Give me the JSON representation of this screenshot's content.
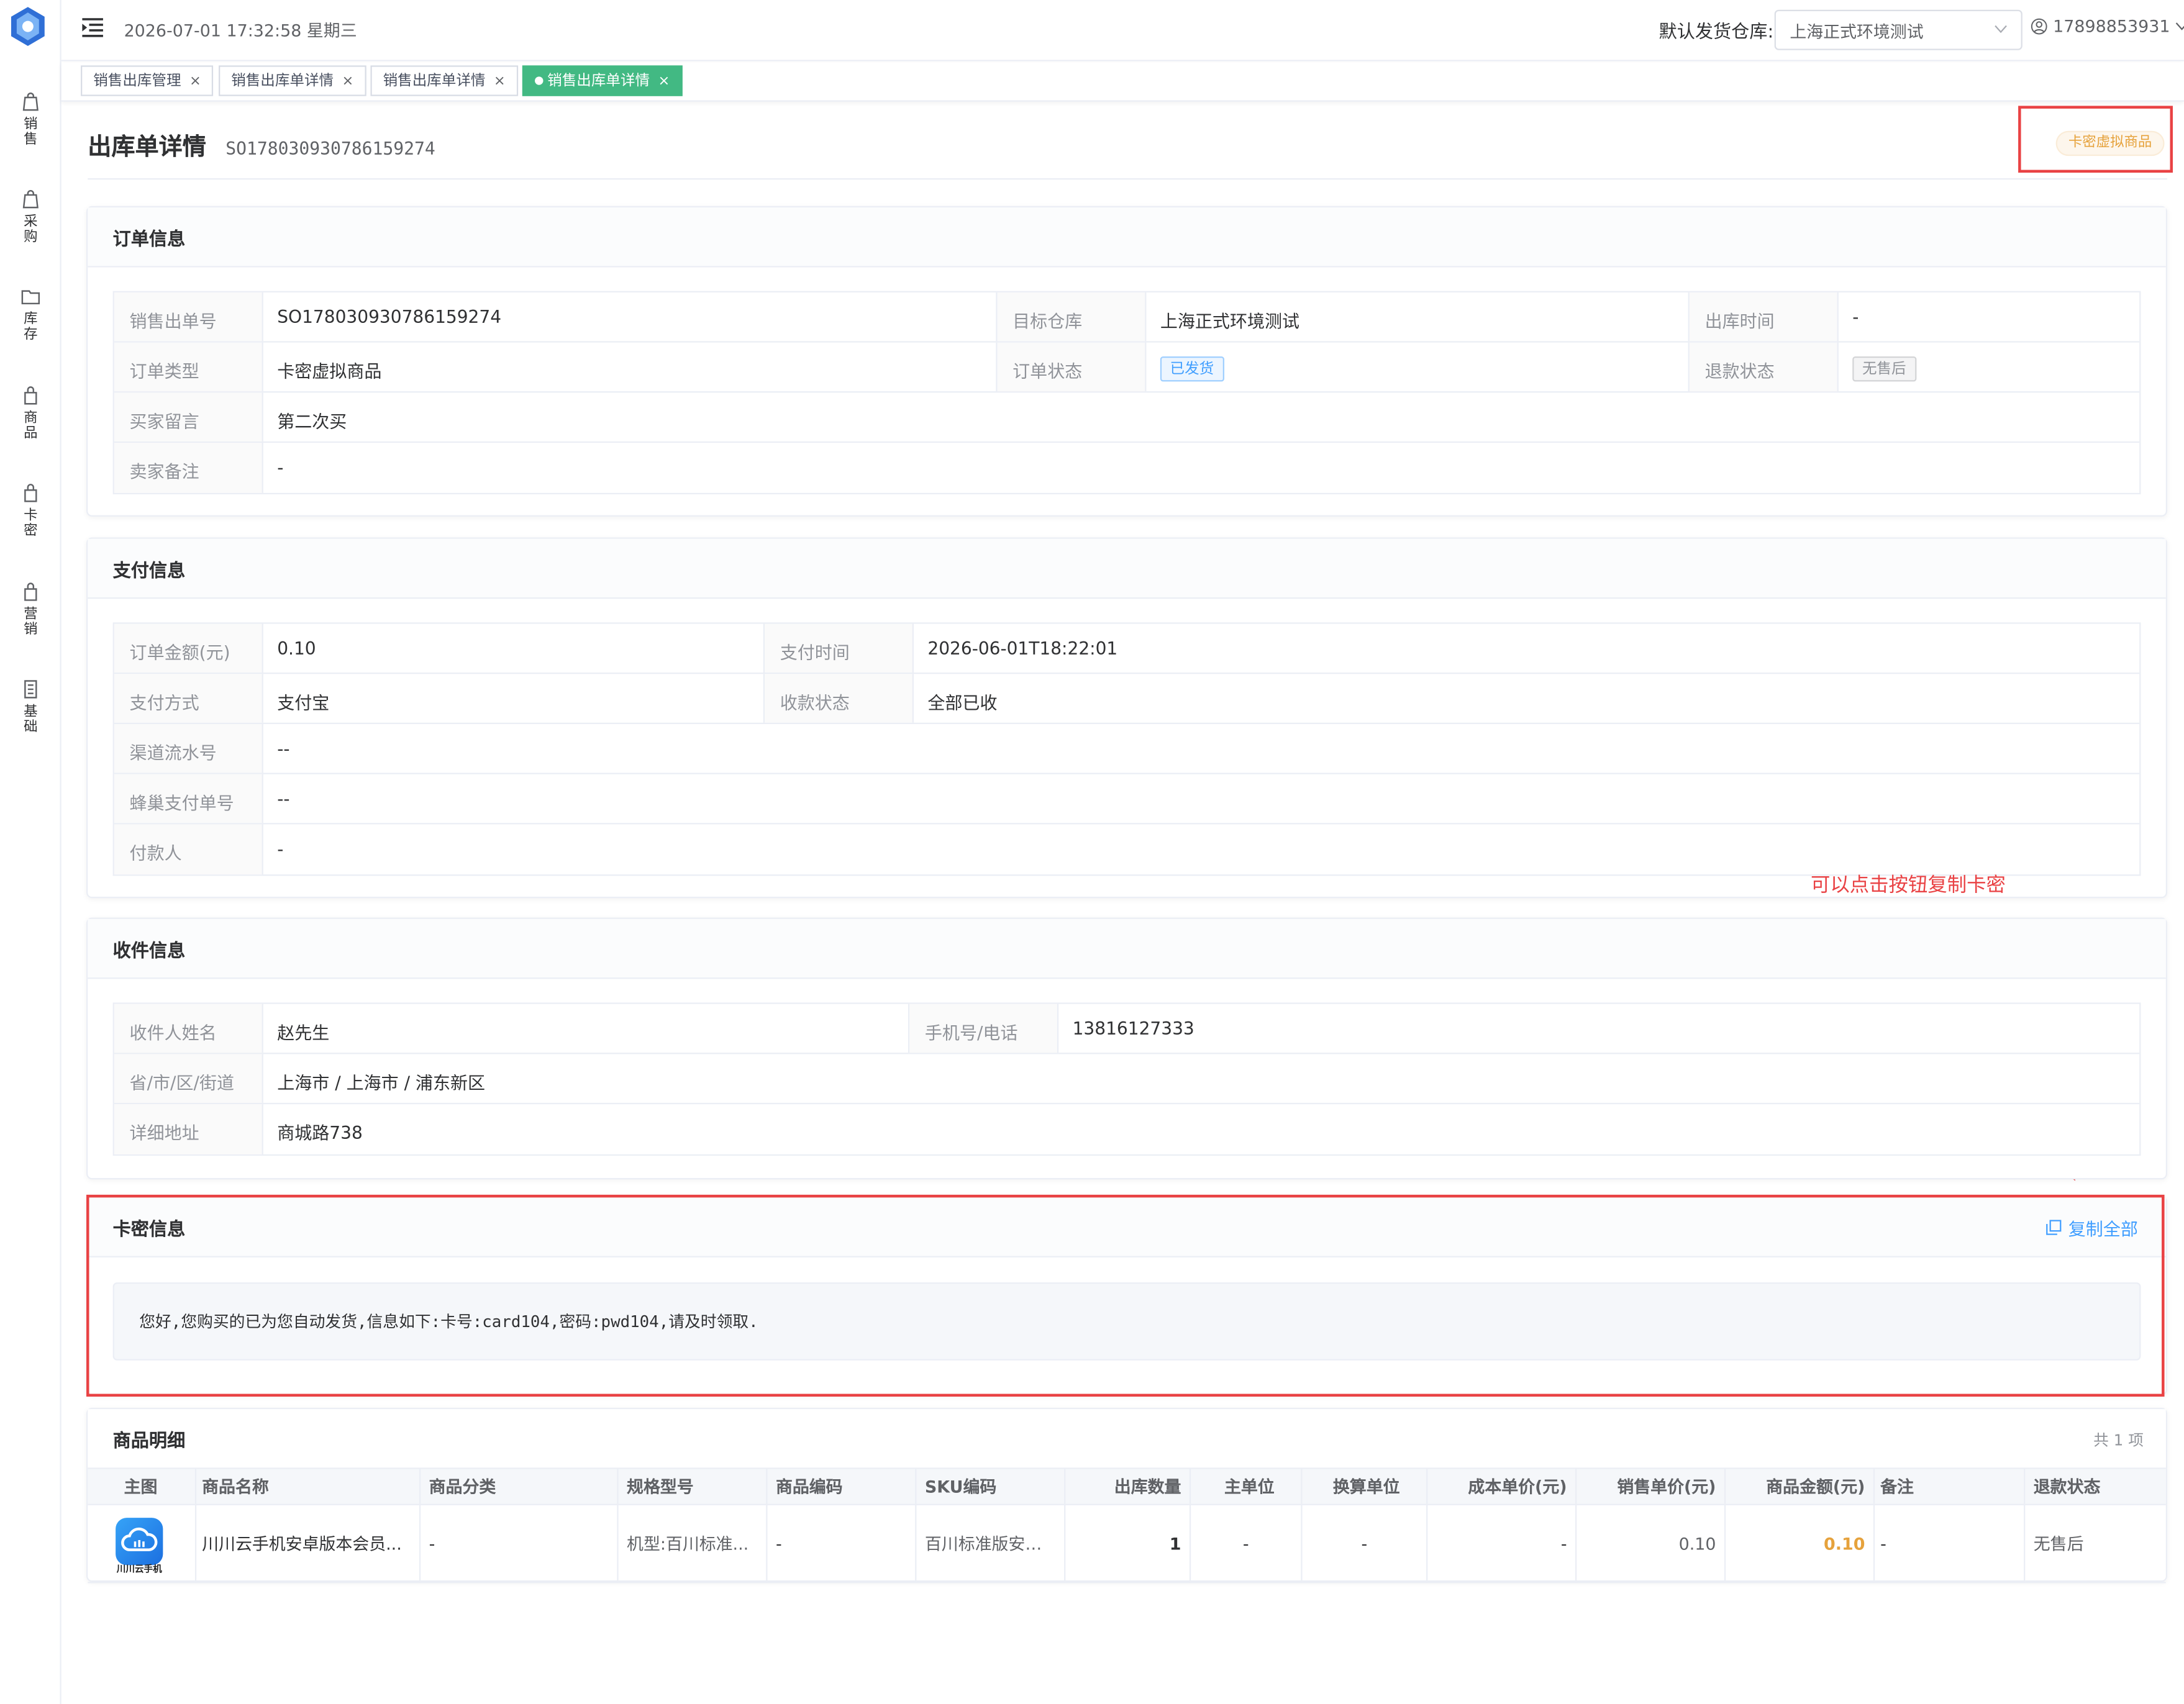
{
  "sidebar": {
    "items": [
      {
        "label": "销售",
        "icon": "sales-bag-icon"
      },
      {
        "label": "采购",
        "icon": "purchase-bag-icon"
      },
      {
        "label": "库存",
        "icon": "inventory-folder-icon"
      },
      {
        "label": "商品",
        "icon": "goods-bag-icon"
      },
      {
        "label": "卡密",
        "icon": "card-bag-icon"
      },
      {
        "label": "营销",
        "icon": "marketing-bag-icon"
      },
      {
        "label": "基础",
        "icon": "basic-book-icon"
      }
    ]
  },
  "topbar": {
    "datetime": "2026-07-01 17:32:58 星期三",
    "warehouse_label": "默认发货仓库:",
    "warehouse_value": "上海正式环境测试",
    "user": "17898853931"
  },
  "tabs": [
    {
      "label": "销售出库管理"
    },
    {
      "label": "销售出库单详情"
    },
    {
      "label": "销售出库单详情"
    },
    {
      "label": "销售出库单详情"
    }
  ],
  "page": {
    "title": "出库单详情",
    "code": "SO178030930786159274",
    "type_tag": "卡密虚拟商品"
  },
  "order_info": {
    "title": "订单信息",
    "rows": [
      [
        [
          "销售出单号",
          "SO178030930786159274"
        ],
        [
          "目标仓库",
          "上海正式环境测试"
        ],
        [
          "出库时间",
          "-"
        ]
      ],
      [
        [
          "订单类型",
          "卡密虚拟商品"
        ],
        [
          "订单状态",
          "已发货"
        ],
        [
          "退款状态",
          "无售后"
        ]
      ],
      [
        [
          "买家留言",
          "第二次买"
        ]
      ],
      [
        [
          "卖家备注",
          "-"
        ]
      ]
    ]
  },
  "payment_info": {
    "title": "支付信息",
    "rows": [
      [
        [
          "订单金额(元)",
          "0.10"
        ],
        [
          "支付时间",
          "2026-06-01T18:22:01"
        ]
      ],
      [
        [
          "支付方式",
          "支付宝"
        ],
        [
          "收款状态",
          "全部已收"
        ]
      ],
      [
        [
          "渠道流水号",
          "--"
        ]
      ],
      [
        [
          "蜂巢支付单号",
          "--"
        ]
      ],
      [
        [
          "付款人",
          "-"
        ]
      ]
    ]
  },
  "receiver_info": {
    "title": "收件信息",
    "rows": [
      [
        [
          "收件人姓名",
          "赵先生"
        ],
        [
          "手机号/电话",
          "13816127333"
        ]
      ],
      [
        [
          "省/市/区/街道",
          "上海市 / 上海市 / 浦东新区"
        ]
      ],
      [
        [
          "详细地址",
          "商城路738"
        ]
      ]
    ]
  },
  "annotation": "可以点击按钮复制卡密",
  "card_info": {
    "title": "卡密信息",
    "copy_label": "复制全部",
    "message": "您好,您购买的已为您自动发货,信息如下:卡号:card104,密码:pwd104,请及时领取."
  },
  "products": {
    "title": "商品明细",
    "count": "共 1 项",
    "columns": [
      "主图",
      "商品名称",
      "商品分类",
      "规格型号",
      "商品编码",
      "SKU编码",
      "出库数量",
      "主单位",
      "换算单位",
      "成本单价(元)",
      "销售单价(元)",
      "商品金额(元)",
      "备注",
      "退款状态"
    ],
    "rows": [
      {
        "image_text": "川川云手机",
        "name": "川川云手机安卓版本会员...",
        "category": "-",
        "spec": "机型:百川标准...",
        "code": "-",
        "sku": "百川标准版安卓...",
        "qty": "1",
        "unit": "-",
        "conv_unit": "-",
        "cost": "-",
        "price": "0.10",
        "amount": "0.10",
        "remark": "-",
        "refund": "无售后"
      }
    ]
  },
  "colors": {
    "accent_green": "#42b983",
    "link_blue": "#409eff",
    "highlight_red": "#e94244",
    "amount_orange": "#e6a23c"
  }
}
